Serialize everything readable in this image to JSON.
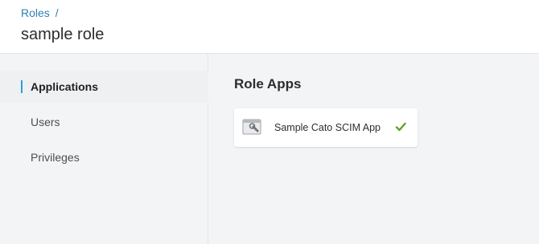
{
  "header": {
    "breadcrumb_link": "Roles",
    "breadcrumb_separator": "/",
    "title": "sample role"
  },
  "sidebar": {
    "items": [
      {
        "label": "Applications",
        "active": true
      },
      {
        "label": "Users",
        "active": false
      },
      {
        "label": "Privileges",
        "active": false
      }
    ]
  },
  "main": {
    "section_title": "Role Apps",
    "apps": [
      {
        "name": "Sample Cato SCIM App",
        "icon": "wrench-window-icon",
        "status_icon": "check-icon"
      }
    ]
  },
  "colors": {
    "accent": "#2f9fd8",
    "link": "#2f7fb5",
    "check": "#5ea32a"
  }
}
